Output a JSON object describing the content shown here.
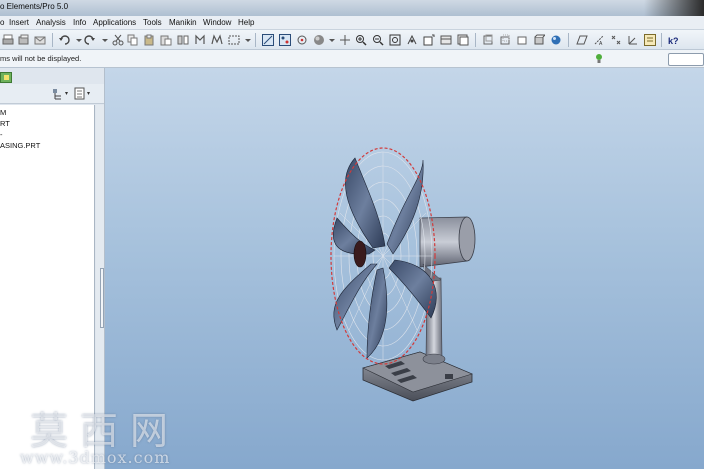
{
  "window": {
    "title": "o Elements/Pro 5.0"
  },
  "menu": [
    {
      "id": "partial",
      "label": "o"
    },
    {
      "id": "insert",
      "label": "Insert"
    },
    {
      "id": "analysis",
      "label": "Analysis"
    },
    {
      "id": "info",
      "label": "Info"
    },
    {
      "id": "applications",
      "label": "Applications"
    },
    {
      "id": "tools",
      "label": "Tools"
    },
    {
      "id": "manikin",
      "label": "Manikin"
    },
    {
      "id": "window",
      "label": "Window"
    },
    {
      "id": "help",
      "label": "Help"
    }
  ],
  "message_bar": {
    "text": "ms will not be displayed."
  },
  "model_tree": {
    "items": [
      "M",
      "RT",
      "-",
      "ASING.PRT"
    ]
  },
  "watermark": {
    "chinese": "莫西网",
    "url": "www.3dmox.com"
  },
  "colors": {
    "viewport_top": "#c4d6e9",
    "viewport_bottom": "#86a8cd",
    "model_edge": "#d23a3a"
  }
}
